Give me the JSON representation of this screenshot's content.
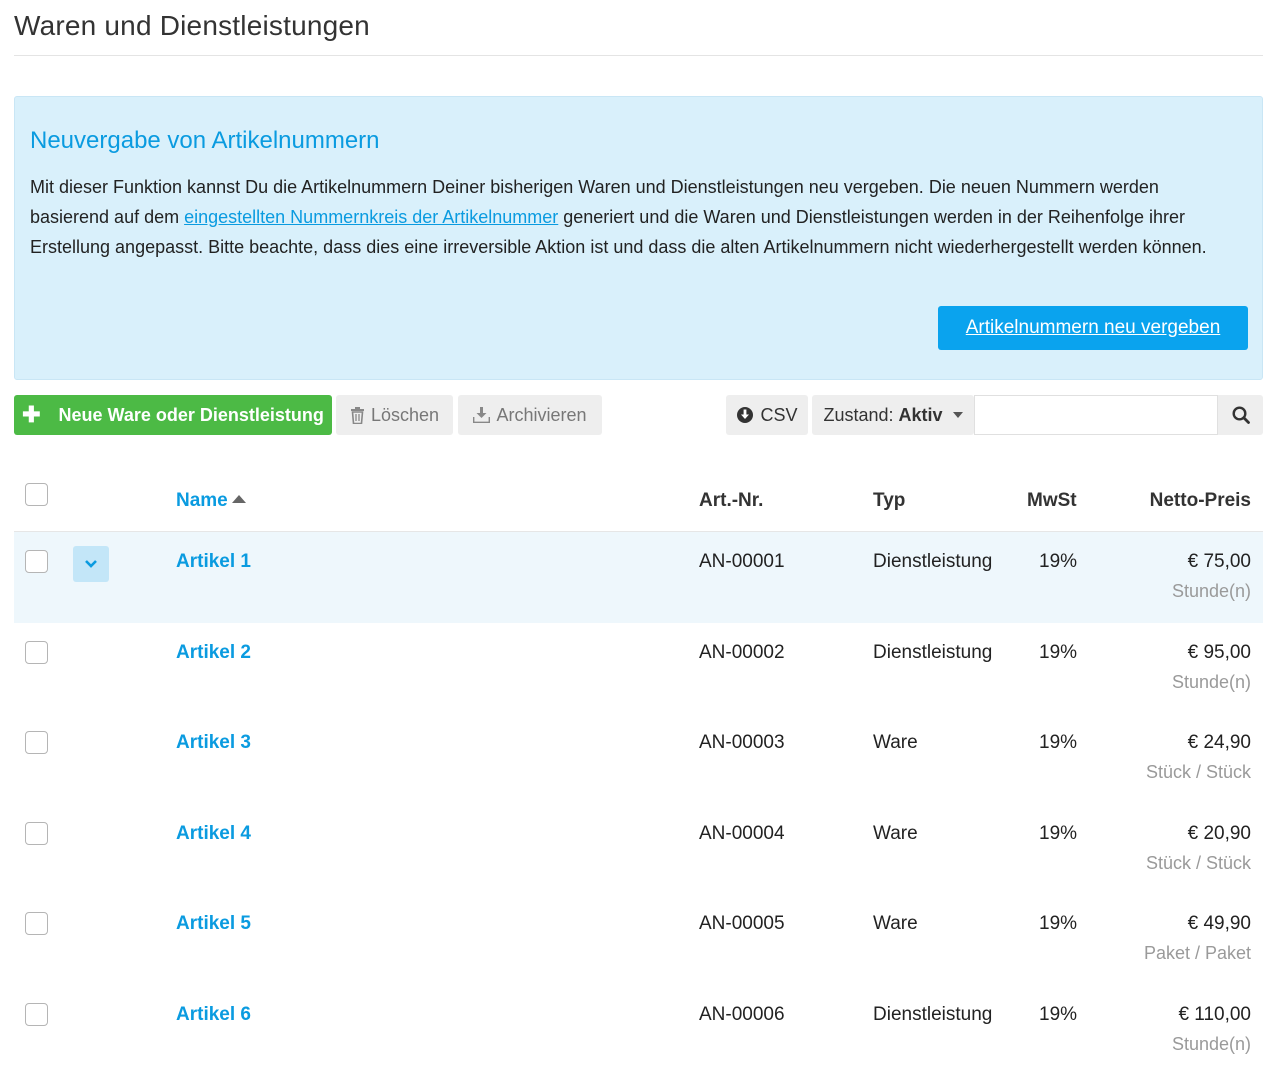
{
  "page": {
    "title": "Waren und Dienstleistungen"
  },
  "info_box": {
    "title": "Neuvergabe von Artikelnummern",
    "text_before_link": "Mit dieser Funktion kannst Du die Artikelnummern Deiner bisherigen Waren und Dienstleistungen neu vergeben. Die neuen Nummern werden basierend auf dem ",
    "link_text": "eingestellten Nummernkreis der Artikelnummer",
    "text_after_link": " generiert und die Waren und Dienstleistungen werden in der Reihenfolge ihrer Erstellung angepasst. Bitte beachte, dass dies eine irreversible Aktion ist und dass die alten Artikelnummern nicht wiederhergestellt werden können.",
    "button_label": "Artikelnummern neu vergeben"
  },
  "toolbar": {
    "new_label": "Neue Ware oder Dienstleistung",
    "delete_label": "Löschen",
    "archive_label": "Archivieren",
    "csv_label": "CSV",
    "state_prefix": "Zustand:",
    "state_value": "Aktiv",
    "search_placeholder": ""
  },
  "table": {
    "headers": {
      "name": "Name",
      "artnr": "Art.-Nr.",
      "typ": "Typ",
      "mwst": "MwSt",
      "price": "Netto-Preis"
    },
    "rows": [
      {
        "name": "Artikel 1",
        "artnr": "AN-00001",
        "typ": "Dienstleistung",
        "mwst": "19%",
        "price": "€ 75,00",
        "unit": "Stunde(n)"
      },
      {
        "name": "Artikel 2",
        "artnr": "AN-00002",
        "typ": "Dienstleistung",
        "mwst": "19%",
        "price": "€ 95,00",
        "unit": "Stunde(n)"
      },
      {
        "name": "Artikel 3",
        "artnr": "AN-00003",
        "typ": "Ware",
        "mwst": "19%",
        "price": "€ 24,90",
        "unit": "Stück / Stück"
      },
      {
        "name": "Artikel 4",
        "artnr": "AN-00004",
        "typ": "Ware",
        "mwst": "19%",
        "price": "€ 20,90",
        "unit": "Stück / Stück"
      },
      {
        "name": "Artikel 5",
        "artnr": "AN-00005",
        "typ": "Ware",
        "mwst": "19%",
        "price": "€ 49,90",
        "unit": "Paket / Paket"
      },
      {
        "name": "Artikel 6",
        "artnr": "AN-00006",
        "typ": "Dienstleistung",
        "mwst": "19%",
        "price": "€ 110,00",
        "unit": "Stunde(n)"
      }
    ]
  },
  "colors": {
    "accent": "#0a9be0",
    "primary_button": "#0aa3ee",
    "new_button": "#4cba45",
    "info_bg": "#d9f0fb",
    "row_highlight": "#eef7fc"
  },
  "icons": {
    "new": "plus-icon",
    "delete": "trash-icon",
    "archive": "download-tray-icon",
    "csv": "download-circle-icon",
    "search": "search-icon",
    "expand": "chevron-down-icon",
    "sort": "sort-ascending-icon"
  }
}
